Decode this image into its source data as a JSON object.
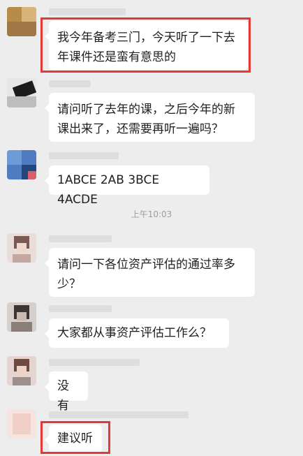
{
  "time_divider": "上午10:03",
  "messages": [
    {
      "text": "我今年备考三门，今天听了一下去年课件还是蛮有意思的",
      "highlighted": true
    },
    {
      "text": "请问听了去年的课，之后今年的新课出来了，还需要再听一遍吗？",
      "highlighted": false
    },
    {
      "text": "1ABCE 2AB 3BCE 4ACDE",
      "highlighted": false
    },
    {
      "text": "请问一下各位资产评估的通过率多少？",
      "highlighted": false
    },
    {
      "text": "大家都从事资产评估工作么？",
      "highlighted": false
    },
    {
      "text": "没有",
      "highlighted": false
    },
    {
      "text": "建议听",
      "highlighted": true
    }
  ],
  "colors": {
    "background": "#ededed",
    "bubble": "#ffffff",
    "highlight": "#e53935",
    "text": "#1f1f1f"
  }
}
